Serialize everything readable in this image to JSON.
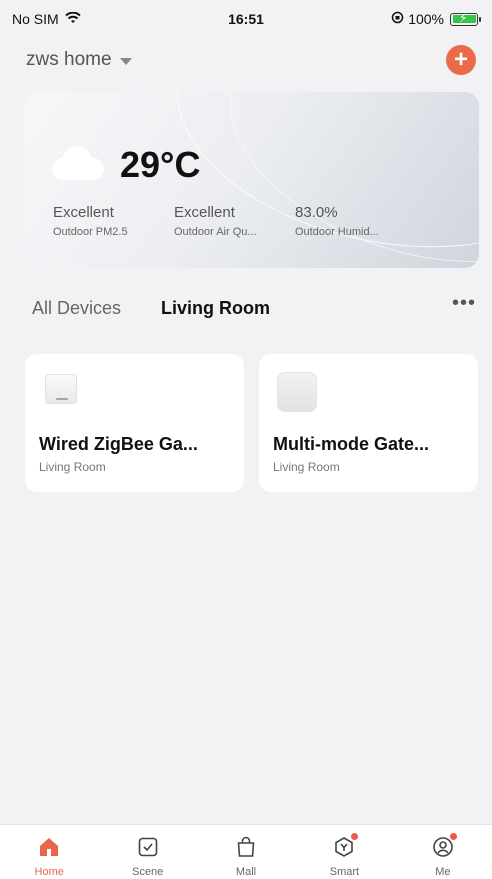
{
  "status_bar": {
    "carrier": "No SIM",
    "time": "16:51",
    "battery": "100%"
  },
  "header": {
    "home_name": "zws home"
  },
  "weather": {
    "temperature": "29°C",
    "icon": "cloud-icon",
    "stats": [
      {
        "value": "Excellent",
        "label": "Outdoor PM2.5"
      },
      {
        "value": "Excellent",
        "label": "Outdoor Air Qu..."
      },
      {
        "value": "83.0%",
        "label": "Outdoor Humid..."
      }
    ]
  },
  "tabs": [
    {
      "label": "All Devices",
      "active": false
    },
    {
      "label": "Living Room",
      "active": true
    }
  ],
  "devices": [
    {
      "name": "Wired ZigBee Ga...",
      "room": "Living Room",
      "icon": "zigbee-gateway-icon"
    },
    {
      "name": "Multi-mode Gate...",
      "room": "Living Room",
      "icon": "multimode-gateway-icon"
    }
  ],
  "bottom_nav": [
    {
      "label": "Home",
      "icon": "home-icon",
      "active": true
    },
    {
      "label": "Scene",
      "icon": "scene-icon",
      "active": false
    },
    {
      "label": "Mall",
      "icon": "mall-bag-icon",
      "active": false
    },
    {
      "label": "Smart",
      "icon": "smart-icon",
      "active": false,
      "badge": true
    },
    {
      "label": "Me",
      "icon": "profile-icon",
      "active": false,
      "badge": true
    }
  ],
  "colors": {
    "accent": "#ec6a48",
    "active_nav": "#e8674a",
    "badge": "#ea5a4a",
    "battery": "#36c54a"
  }
}
